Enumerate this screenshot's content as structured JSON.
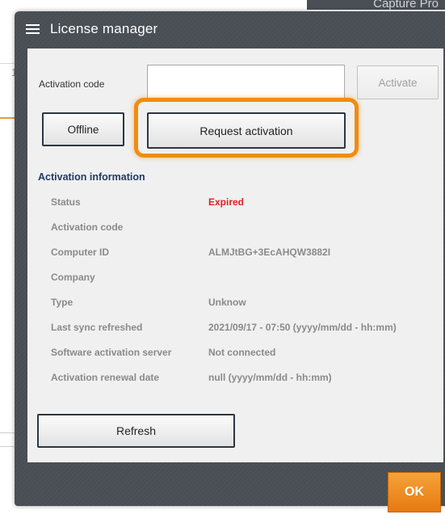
{
  "background": {
    "app_title_fragment": "Capture Pro",
    "edge_digit": "1"
  },
  "dialog": {
    "title": "License manager",
    "menu_icon": "hamburger-menu-icon",
    "activation_code_label": "Activation code",
    "activation_code_value": "",
    "activate_button": "Activate",
    "offline_button": "Offline",
    "request_activation_button": "Request activation",
    "highlight_color": "#f08c12",
    "info_title": "Activation information",
    "info": [
      {
        "key": "Status",
        "value": "Expired"
      },
      {
        "key": "Activation code",
        "value": ""
      },
      {
        "key": "Computer ID",
        "value": "ALMJtBG+3EcAHQW3882I"
      },
      {
        "key": "Company",
        "value": ""
      },
      {
        "key": "Type",
        "value": "Unknow"
      },
      {
        "key": "Last sync refreshed",
        "value": "2021/09/17 - 07:50 (yyyy/mm/dd - hh:mm)"
      },
      {
        "key": "Software activation server",
        "value": "Not connected"
      },
      {
        "key": "Activation renewal date",
        "value": "null (yyyy/mm/dd - hh:mm)"
      }
    ],
    "refresh_button": "Refresh",
    "ok_button": "OK"
  },
  "colors": {
    "status_expired": "#e02020",
    "ok_accent": "#f08c12",
    "section_title": "#1e3a66"
  }
}
